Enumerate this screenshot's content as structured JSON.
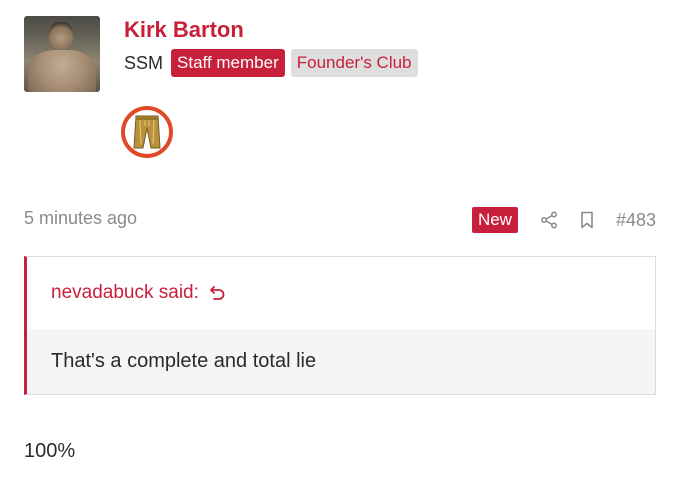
{
  "user": {
    "name": "Kirk Barton",
    "title": "SSM",
    "banners": {
      "staff": "Staff member",
      "founder": "Founder's Club"
    }
  },
  "post": {
    "time": "5 minutes ago",
    "new_label": "New",
    "number": "#483",
    "quote": {
      "author": "nevadabuck said:",
      "text": "That's a complete and total lie"
    },
    "message": "100%"
  },
  "icons": {
    "share": "share-icon",
    "bookmark": "bookmark-icon",
    "quote_jump": "jump-back-icon",
    "trophy": "trophy-pants-icon"
  },
  "colors": {
    "accent": "#c8203a",
    "trophy_ring": "#de4a28",
    "muted": "#8a8a8a"
  }
}
